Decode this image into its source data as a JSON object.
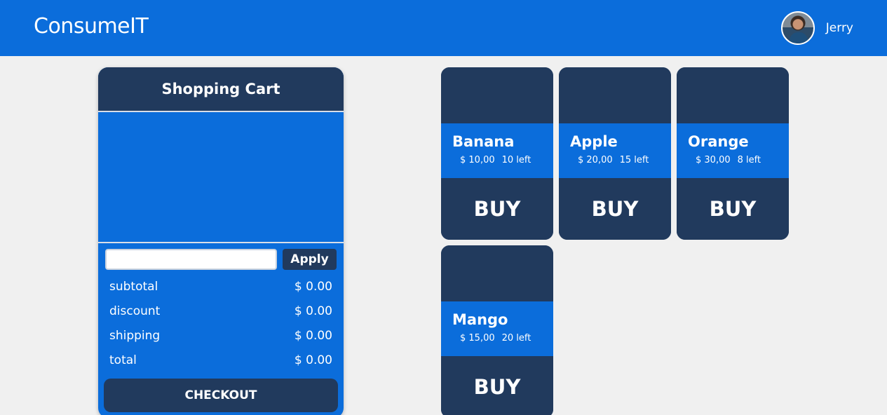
{
  "header": {
    "brand": "ConsumeIT",
    "user_name": "Jerry",
    "brand_color": "#0b6ddb"
  },
  "cart": {
    "title": "Shopping Cart",
    "coupon_placeholder": "",
    "coupon_value": "",
    "apply_label": "Apply",
    "summary": [
      {
        "label": "subtotal",
        "value": "$ 0.00"
      },
      {
        "label": "discount",
        "value": "$ 0.00"
      },
      {
        "label": "shipping",
        "value": "$ 0.00"
      },
      {
        "label": "total",
        "value": "$ 0.00"
      }
    ],
    "checkout_label": "CHECKOUT"
  },
  "products": [
    {
      "name": "Banana",
      "price": "$ 10,00",
      "stock": "10 left",
      "buy_label": "BUY"
    },
    {
      "name": "Apple",
      "price": "$ 20,00",
      "stock": "15 left",
      "buy_label": "BUY"
    },
    {
      "name": "Orange",
      "price": "$ 30,00",
      "stock": "8 left",
      "buy_label": "BUY"
    },
    {
      "name": "Mango",
      "price": "$ 15,00",
      "stock": "20 left",
      "buy_label": "BUY"
    }
  ],
  "colors": {
    "primary": "#0b6ddb",
    "dark": "#213a5d",
    "background": "#f0f0f0"
  }
}
